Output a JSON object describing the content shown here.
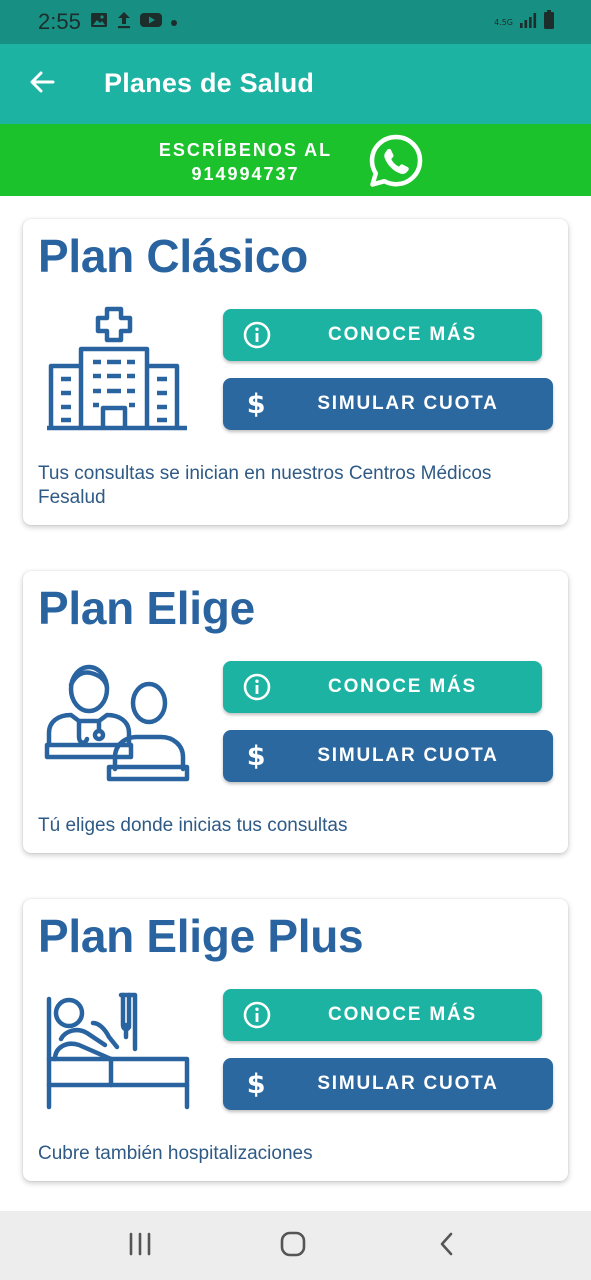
{
  "status_bar": {
    "time": "2:55",
    "network_label": "4.5G",
    "icons": [
      "image-icon",
      "upload-icon",
      "youtube-icon",
      "dot-icon",
      "signal-icon",
      "battery-icon"
    ]
  },
  "app_bar": {
    "title": "Planes de Salud",
    "back_icon": "arrow-back-icon"
  },
  "whatsapp_banner": {
    "line1": "ESCRÍBENOS AL",
    "line2": "914994737",
    "icon": "whatsapp-icon"
  },
  "plans": [
    {
      "title": "Plan Clásico",
      "illustration": "hospital-icon",
      "more_label": "CONOCE MÁS",
      "simulate_label": "SIMULAR CUOTA",
      "description": "Tus consultas se inician en nuestros Centros Médicos Fesalud"
    },
    {
      "title": "Plan Elige",
      "illustration": "doctor-patient-icon",
      "more_label": "CONOCE MÁS",
      "simulate_label": "SIMULAR CUOTA",
      "description": "Tú eliges donde inicias tus consultas"
    },
    {
      "title": "Plan Elige Plus",
      "illustration": "hospital-bed-icon",
      "more_label": "CONOCE MÁS",
      "simulate_label": "SIMULAR CUOTA",
      "description": "Cubre también hospitalizaciones"
    }
  ],
  "nav_bar": {
    "buttons": [
      "recent-apps-icon",
      "home-icon",
      "back-icon"
    ]
  },
  "colors": {
    "status_bar": "#188f83",
    "app_bar": "#1db3a2",
    "whatsapp_banner": "#1bc22b",
    "primary_blue": "#2a64a0",
    "button_teal": "#1db3a2",
    "button_blue": "#2c68a0"
  }
}
